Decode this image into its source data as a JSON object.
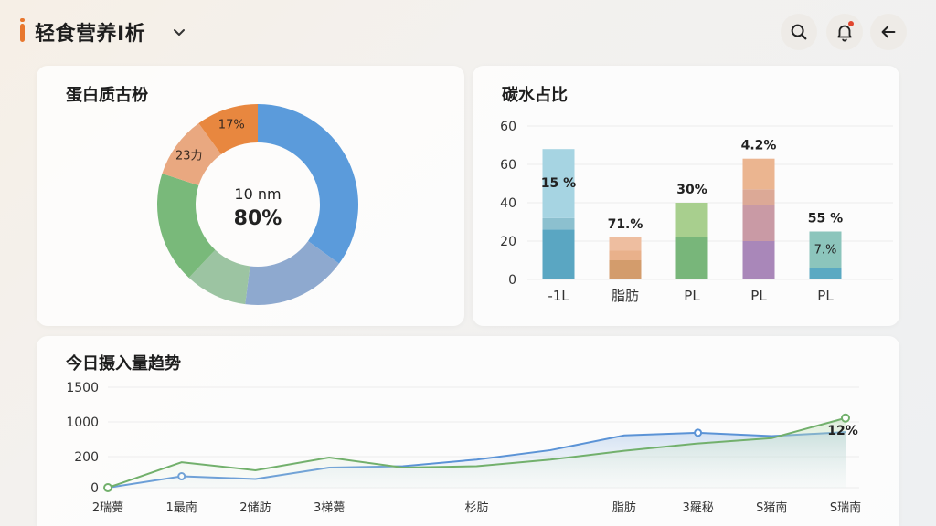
{
  "header": {
    "title": "轻食营养I析",
    "icons": [
      "search-icon",
      "bell-icon",
      "back-arrow-icon"
    ],
    "accent_color": "#e8772e"
  },
  "protein_card": {
    "title": "蛋白质古枌",
    "center_line1": "10 nm",
    "center_line2": "80%",
    "chart_data": {
      "type": "pie",
      "variant": "donut",
      "slices": [
        {
          "label": "",
          "value": 35,
          "color": "#5b9bdb"
        },
        {
          "label": "",
          "value": 17,
          "color": "#8ea9cf"
        },
        {
          "label": "",
          "value": 10,
          "color": "#9cc4a2"
        },
        {
          "label": "",
          "value": 18,
          "color": "#79b97a"
        },
        {
          "label": "23力",
          "value": 10,
          "color": "#e9a880"
        },
        {
          "label": "17%",
          "value": 10,
          "color": "#e8873f"
        }
      ]
    }
  },
  "carb_card": {
    "title": "碳水占比",
    "chart_data": {
      "type": "bar",
      "stacked": true,
      "categories": [
        "-1L",
        "脂肪",
        "PL",
        "PL",
        "PL"
      ],
      "ylim": [
        0,
        60
      ],
      "yticks": [
        "0",
        "20",
        "40",
        "60",
        "60"
      ],
      "bars": [
        {
          "label": "15 %",
          "segments": [
            {
              "value": 26,
              "color": "#5aa6c2"
            },
            {
              "value": 6,
              "color": "#8cc0cf"
            },
            {
              "value": 36,
              "color": "#a6d4e2"
            }
          ]
        },
        {
          "label": "71.%",
          "segments": [
            {
              "value": 10,
              "color": "#d39c6c"
            },
            {
              "value": 5,
              "color": "#e9b18b"
            },
            {
              "value": 7,
              "color": "#eebea0"
            }
          ]
        },
        {
          "label": "30%",
          "segments": [
            {
              "value": 22,
              "color": "#78b67a"
            },
            {
              "value": 18,
              "color": "#a8cf8e"
            }
          ]
        },
        {
          "label": "4.2%",
          "segments": [
            {
              "value": 20,
              "color": "#a987b9"
            },
            {
              "value": 19,
              "color": "#c99aa5"
            },
            {
              "value": 8,
              "color": "#dca996"
            },
            {
              "value": 16,
              "color": "#ebb590"
            }
          ]
        },
        {
          "label": "55 %",
          "sublabel": "7.%",
          "segments": [
            {
              "value": 6,
              "color": "#5aa9c2"
            },
            {
              "value": 19,
              "color": "#8cc5bc"
            }
          ]
        }
      ]
    }
  },
  "trend_card": {
    "title": "今日摄入量趋势",
    "end_label": "12%",
    "chart_data": {
      "type": "line",
      "x": [
        "2瑞薨",
        "1最南",
        "2储肪",
        "3梯薨",
        "",
        "杉肪",
        "",
        "脂肪",
        "3羅秘",
        "S猪南",
        "S瑞南"
      ],
      "yticks": [
        "0",
        "200",
        "1000",
        "1500"
      ],
      "series": [
        {
          "color": "#5b93d6",
          "values": [
            0,
            170,
            130,
            300,
            320,
            420,
            560,
            780,
            820,
            770,
            830
          ]
        },
        {
          "color": "#72b06c",
          "values": [
            0,
            380,
            260,
            450,
            300,
            320,
            420,
            550,
            660,
            740,
            1040
          ]
        }
      ]
    }
  }
}
